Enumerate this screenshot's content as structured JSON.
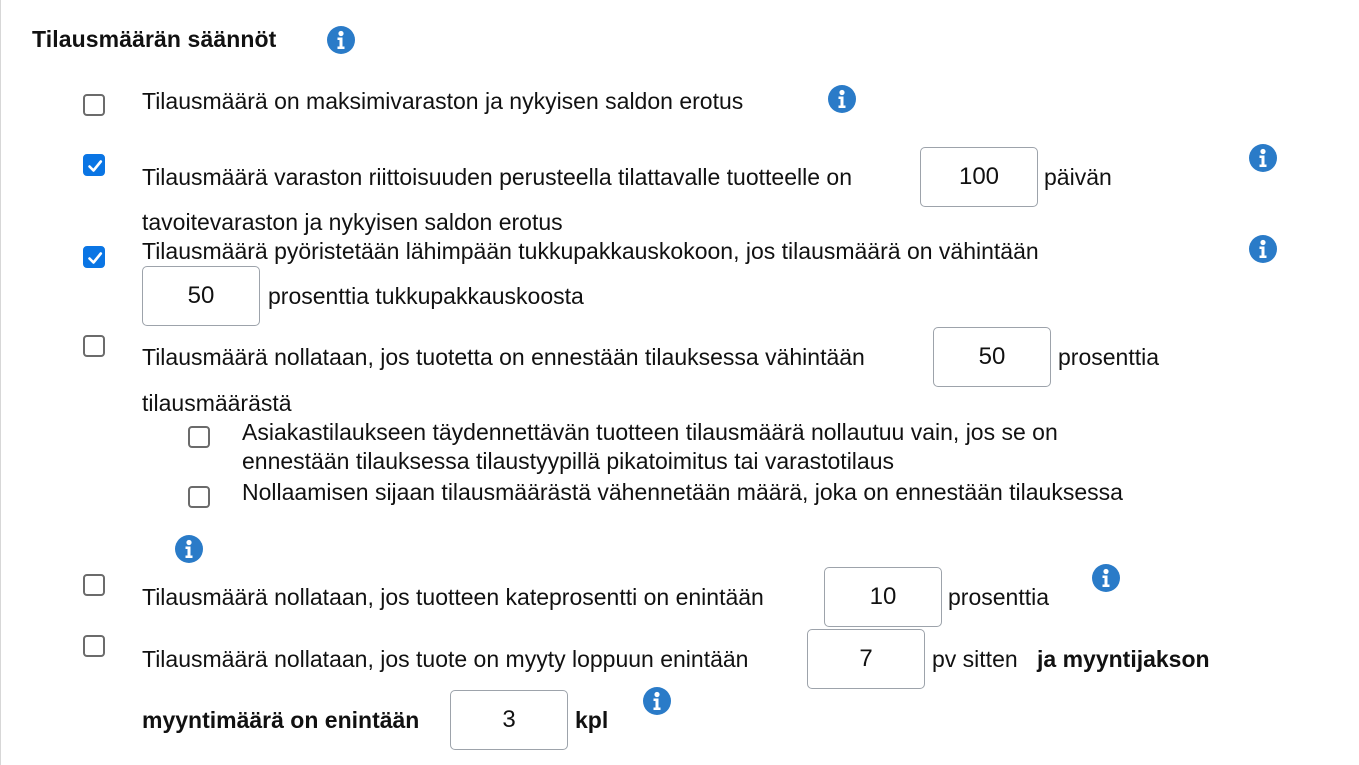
{
  "section": {
    "title": "Tilausmäärän säännöt"
  },
  "rules": {
    "r1": {
      "checked": false,
      "text": "Tilausmäärä on maksimivaraston ja nykyisen saldon erotus"
    },
    "r2": {
      "checked": true,
      "text_before": "Tilausmäärä varaston riittoisuuden perusteella tilattavalle tuotteelle on",
      "value": "100",
      "text_after": "päivän",
      "text_line2": "tavoitevaraston ja nykyisen saldon erotus"
    },
    "r3": {
      "checked": true,
      "text_line1": "Tilausmäärä pyöristetään lähimpään tukkupakkauskokoon, jos tilausmäärä on vähintään",
      "value": "50",
      "text_after": "prosenttia tukkupakkauskoosta"
    },
    "r4": {
      "checked": false,
      "text_before": "Tilausmäärä nollataan, jos tuotetta on ennestään tilauksessa vähintään",
      "value": "50",
      "text_after": "prosenttia",
      "text_line2": "tilausmäärästä",
      "sub1": {
        "checked": false,
        "line1": "Asiakastilaukseen täydennettävän tuotteen tilausmäärä nollautuu vain, jos se on",
        "line2": "ennestään tilauksessa tilaustyypillä pikatoimitus tai varastotilaus"
      },
      "sub2": {
        "checked": false,
        "text": "Nollaamisen sijaan tilausmäärästä vähennetään määrä, joka on ennestään tilauksessa"
      }
    },
    "r5": {
      "checked": false,
      "text_before": "Tilausmäärä nollataan, jos tuotteen kateprosentti on enintään",
      "value": "10",
      "text_after": "prosenttia"
    },
    "r6": {
      "checked": false,
      "text_before": "Tilausmäärä nollataan, jos tuote on myyty loppuun enintään",
      "value1": "7",
      "text_mid": "pv sitten",
      "text_bold1": "ja myyntijakson",
      "text_bold2": "myyntimäärä on enintään",
      "value2": "3",
      "text_unit": "kpl"
    }
  },
  "colors": {
    "accent": "#0a75e4",
    "info": "#2a7bc8",
    "input_border": "#9da3ab"
  },
  "icons": {
    "info": "info-circle-icon",
    "check": "checkmark-icon"
  }
}
